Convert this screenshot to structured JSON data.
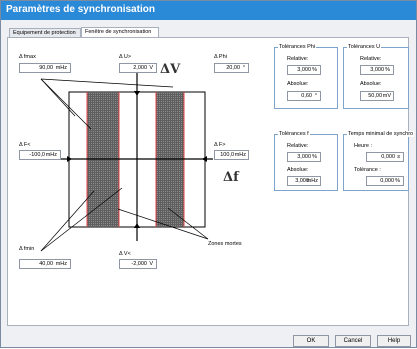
{
  "window": {
    "title": "Paramètres de synchronisation"
  },
  "tabs": [
    {
      "label": "Equipement de protection"
    },
    {
      "label": "Fenêtre de synchronisation"
    }
  ],
  "diagram": {
    "dfmax_label": "Δ fmax",
    "dfmax_value": "90,00",
    "dfmax_unit": "mHz",
    "dvpos_label": "Δ U>",
    "dvpos_value": "2,000",
    "dvpos_unit": "V",
    "dphi_label": "Δ Phi",
    "dphi_value": "20,00",
    "dphi_unit": "°",
    "dv_big": "ΔV",
    "dfneg_label": "Δ F<",
    "dfneg_value": "-100,0",
    "dfneg_unit": "mHz",
    "dfpos_label": "Δ F>",
    "dfpos_value": "100,0",
    "dfpos_unit": "mHz",
    "df_big": "Δf",
    "dfmin_label": "Δ fmin",
    "dfmin_value": "40,00",
    "dfmin_unit": "mHz",
    "dvneg_label": "Δ V<",
    "dvneg_value": "-2,000",
    "dvneg_unit": "V",
    "dead_zones": "Zones mortes"
  },
  "tol_phi": {
    "title": "Tolérances Phi",
    "relative_label": "Relative:",
    "relative_value": "3,000",
    "relative_unit": "%",
    "absolute_label": "Absolue:",
    "absolute_value": "0,60",
    "absolute_unit": "°"
  },
  "tol_u": {
    "title": "Tolérances U",
    "relative_label": "Relative:",
    "relative_value": "3,000",
    "relative_unit": "%",
    "absolute_label": "Absolue:",
    "absolute_value": "50,00",
    "absolute_unit": "mV"
  },
  "tol_f": {
    "title": "Tolérances f",
    "relative_label": "Relative:",
    "relative_value": "3,000",
    "relative_unit": "%",
    "absolute_label": "Absolue:",
    "absolute_value": "3,000",
    "absolute_unit": "mHz"
  },
  "min_time": {
    "title": "Temps minimal de synchro",
    "hour_label": "Heure :",
    "hour_value": "0,000",
    "hour_unit": "s",
    "tol_label": "Tolérance :",
    "tol_value": "0,000",
    "tol_unit": "%"
  },
  "buttons": {
    "ok": "OK",
    "cancel": "Cancel",
    "help": "Help"
  },
  "colors": {
    "titlebar": "#2a8ad8",
    "hatch": "#6e6e6e",
    "dead_zone_edge": "#e04040",
    "group_border": "#7ea4cc"
  }
}
